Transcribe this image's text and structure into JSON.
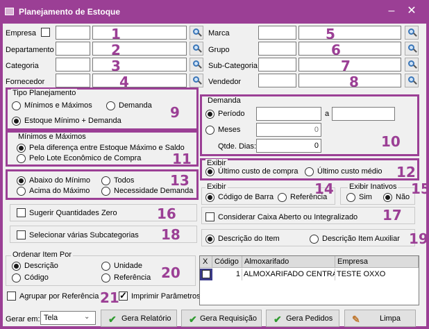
{
  "window": {
    "title": "Planejamento de Estoque",
    "min": "–",
    "close": "✕"
  },
  "filters_left": [
    {
      "label": "Empresa",
      "num": "1"
    },
    {
      "label": "Departamento",
      "num": "2"
    },
    {
      "label": "Categoria",
      "num": "3"
    },
    {
      "label": "Fornecedor",
      "num": "4"
    }
  ],
  "filters_right": [
    {
      "label": "Marca",
      "num": "5"
    },
    {
      "label": "Grupo",
      "num": "6"
    },
    {
      "label": "Sub-Categoria",
      "num": "7"
    },
    {
      "label": "Vendedor",
      "num": "8"
    }
  ],
  "tipo": {
    "title": "Tipo Planejamento",
    "opt_minmax": "Mínimos e Máximos",
    "opt_demanda": "Demanda",
    "opt_estoque": "Estoque Mínimo + Demanda",
    "num": "9"
  },
  "minmax": {
    "title": "Mínimos e Máximos",
    "opt1": "Pela diferença entre Estoque Máximo e Saldo",
    "opt2": "Pelo Lote Econômico de Compra",
    "num": "11"
  },
  "abaixo": {
    "opt_abaixo": "Abaixo do Mínimo",
    "opt_todos": "Todos",
    "opt_acima": "Acima do Máximo",
    "opt_necessidade": "Necessidade Demanda",
    "num": "13"
  },
  "demanda": {
    "title": "Demanda",
    "periodo": "Período",
    "a": "a",
    "meses": "Meses",
    "meses_value": "0",
    "qtde_label": "Qtde. Dias:",
    "qtde_value": "0",
    "num": "10"
  },
  "exibir1": {
    "title": "Exibir",
    "opt1": "Último custo de compra",
    "opt2": "Último custo médio",
    "num": "12"
  },
  "exibir2": {
    "title": "Exibir",
    "opt1": "Código de Barra",
    "opt2": "Referência",
    "num": "14"
  },
  "inativos": {
    "title": "Exibir Inativos",
    "sim": "Sim",
    "nao": "Não",
    "num": "15"
  },
  "sugerir": {
    "label": "Sugerir Quantidades Zero",
    "num": "16"
  },
  "caixa": {
    "label": "Considerar Caixa Aberto ou Integralizado",
    "num": "17"
  },
  "subcat": {
    "label": "Selecionar várias Subcategorias",
    "num": "18"
  },
  "descricao": {
    "opt1": "Descrição do Item",
    "opt2": "Descrição Item Auxiliar",
    "num": "19"
  },
  "ordenar": {
    "title": "Ordenar Item Por",
    "descricao": "Descrição",
    "unidade": "Unidade",
    "codigo": "Código",
    "referencia": "Referência",
    "num": "20"
  },
  "agrupar": {
    "label": "Agrupar por Referência",
    "num": "21"
  },
  "imprimir": {
    "label": "Imprimir Parâmetros"
  },
  "grid": {
    "headers": [
      "X",
      "Código",
      "Almoxarifado",
      "Empresa"
    ],
    "row": {
      "codigo": "1",
      "almox": "ALMOXARIFADO CENTRA",
      "empresa": "TESTE OXXO"
    }
  },
  "bottom": {
    "gerar_label": "Gerar em:",
    "gerar_value": "Tela",
    "btn_relatorio": "Gera Relatório",
    "btn_requisicao": "Gera Requisição",
    "btn_pedidos": "Gera Pedidos",
    "btn_limpa": "Limpa"
  },
  "colors": {
    "accent": "#9b3f95",
    "client": "#f0f0f0"
  }
}
